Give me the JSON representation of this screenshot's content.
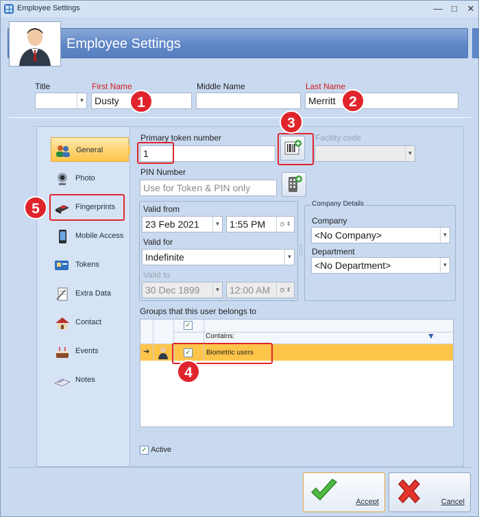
{
  "window": {
    "title": "Employee Settings",
    "minimize_glyph": "—",
    "maximize_glyph": "□",
    "close_glyph": "✕"
  },
  "banner": {
    "title": "Employee Settings"
  },
  "name_row": {
    "title_label": "Title",
    "title_value": "",
    "first_name_label": "First Name",
    "first_name_value": "Dusty",
    "middle_name_label": "Middle Name",
    "middle_name_value": "",
    "last_name_label": "Last Name",
    "last_name_value": "Merritt"
  },
  "nav": {
    "items": [
      {
        "label": "General",
        "icon": "people-icon",
        "active": true
      },
      {
        "label": "Photo",
        "icon": "webcam-icon",
        "active": false
      },
      {
        "label": "Fingerprints",
        "icon": "fingerprint-reader-icon",
        "active": false
      },
      {
        "label": "Mobile Access",
        "icon": "phone-icon",
        "active": false
      },
      {
        "label": "Tokens",
        "icon": "card-icon",
        "active": false
      },
      {
        "label": "Extra Data",
        "icon": "notepad-icon",
        "active": false
      },
      {
        "label": "Contact",
        "icon": "house-icon",
        "active": false
      },
      {
        "label": "Events",
        "icon": "cake-icon",
        "active": false
      },
      {
        "label": "Notes",
        "icon": "notes-icon",
        "active": false
      }
    ]
  },
  "general": {
    "primary_token_label": "Primary token number",
    "primary_token_value": "1",
    "facility_code_label": "Facility code",
    "pin_label": "PIN Number",
    "pin_placeholder": "Use for Token & PIN only",
    "valid_from_label": "Valid from",
    "valid_from_date": "23 Feb 2021",
    "valid_from_time": "1:55 PM",
    "valid_for_label": "Valid for",
    "valid_for_value": "Indefinite",
    "valid_to_label": "Valid to",
    "valid_to_date": "30 Dec 1899",
    "valid_to_time": "12:00 AM",
    "company_details_legend": "Company Details",
    "company_label": "Company",
    "company_value": "<No Company>",
    "department_label": "Department",
    "department_value": "<No Department>",
    "groups_label": "Groups that this user belongs to",
    "grid_contains_label": "Contains:",
    "grid_rows": [
      {
        "checked": true,
        "name": "Biometric users"
      }
    ],
    "active_label": "Active",
    "active_checked": true
  },
  "callouts": {
    "one": "1",
    "two": "2",
    "three": "3",
    "four": "4",
    "five": "5"
  },
  "buttons": {
    "accept": "Accept",
    "cancel": "Cancel"
  },
  "colors": {
    "accent": "#ffc54a",
    "callout": "#e0242b",
    "banner": "#5f86c6"
  }
}
